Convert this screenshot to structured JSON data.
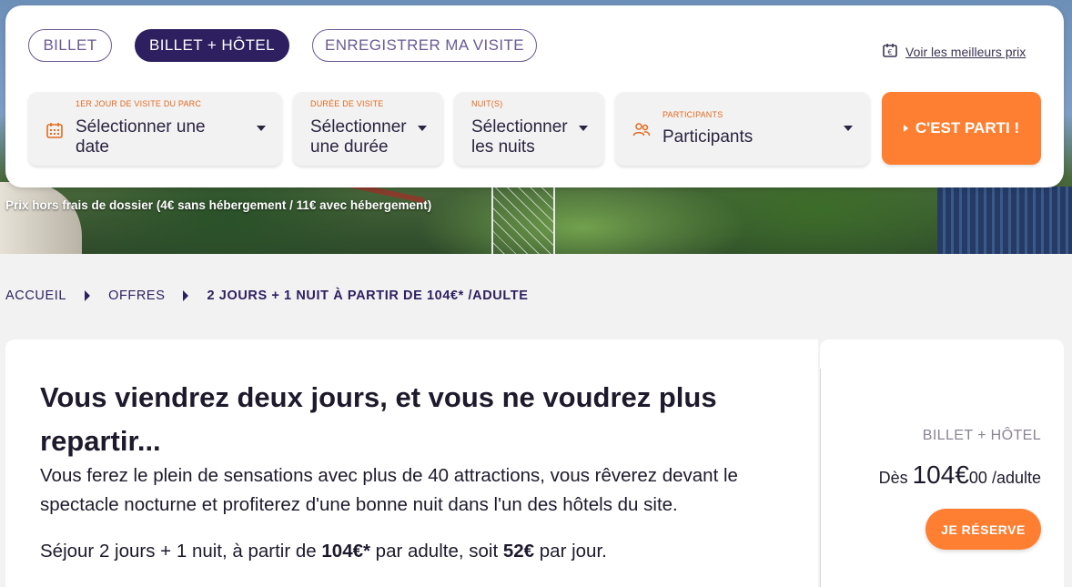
{
  "booking": {
    "tabs": [
      {
        "label": "BILLET",
        "active": false
      },
      {
        "label": "BILLET + HÔTEL",
        "active": true
      },
      {
        "label": "ENREGISTRER MA VISITE",
        "active": false
      }
    ],
    "best_price_link": "Voir les meilleurs prix",
    "fields": {
      "date": {
        "label": "1ER JOUR DE VISITE DU PARC",
        "line1": "Sélectionner une",
        "line2": "date",
        "icon": "calendar-icon"
      },
      "duration": {
        "label": "DURÉE DE VISITE",
        "line1": "Sélectionner",
        "line2": "une durée"
      },
      "nights": {
        "label": "NUIT(S)",
        "line1": "Sélectionner",
        "line2": "les nuits"
      },
      "participants": {
        "label": "PARTICIPANTS",
        "value": "Participants",
        "icon": "participants-icon"
      }
    },
    "submit_label": "C'EST PARTI !"
  },
  "hero": {
    "note": "Prix hors frais de dossier (4€ sans hébergement / 11€ avec hébergement)"
  },
  "breadcrumb": {
    "items": [
      "ACCUEIL",
      "OFFRES"
    ],
    "current": "2 JOURS + 1 NUIT À PARTIR DE 104€* /ADULTE"
  },
  "offer": {
    "headline": "Vous viendrez deux jours, et vous ne voudrez plus repartir...",
    "description": "Vous ferez le plein de sensations avec plus de 40 attractions, vous rêverez devant le spectacle nocturne et profiterez d'une bonne nuit dans l'un des hôtels du site.",
    "stay_prefix": "Séjour 2 jours + 1 nuit, à partir de ",
    "stay_price": "104€*",
    "stay_middle": " par adulte, soit ",
    "stay_daily": "52€",
    "stay_suffix": " par jour."
  },
  "pricing": {
    "type": "BILLET + HÔTEL",
    "from": "Dès",
    "price_main": "104€",
    "price_cents": "00",
    "unit": "/adulte",
    "reserve_label": "JE RÉSERVE"
  },
  "colors": {
    "primary": "#2e2060",
    "accent": "#ff7f32",
    "label": "#e46a1f"
  }
}
